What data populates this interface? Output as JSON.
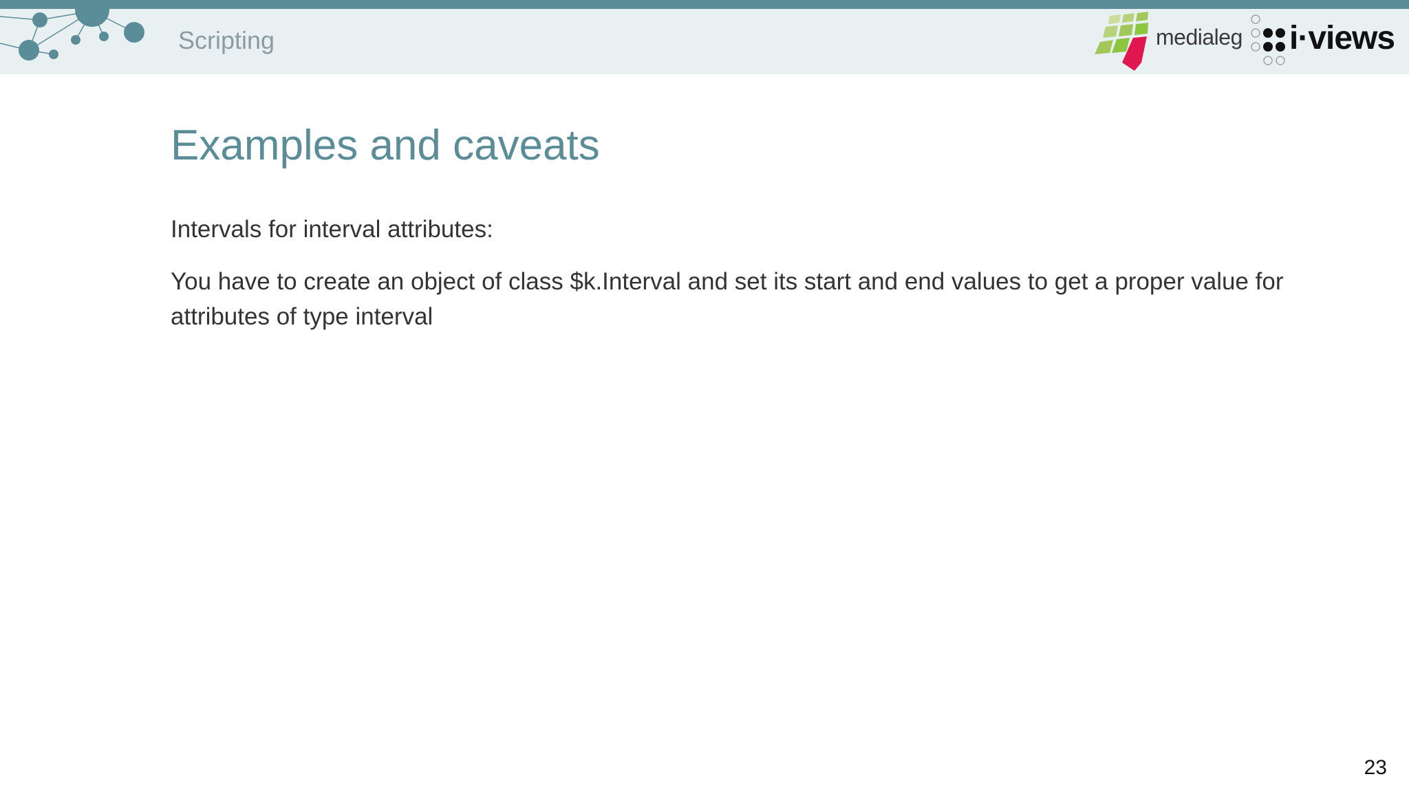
{
  "header": {
    "section": "Scripting",
    "medialeg_logo_text": "medialeg",
    "iviews_logo_text": "i·views"
  },
  "slide": {
    "title": "Examples and caveats",
    "subtitle": "Intervals for interval attributes:",
    "body": "You have to create an object of class $k.Interval and set its start and end values to get a proper value for attributes of type interval",
    "page_number": "23"
  },
  "colors": {
    "accent": "#5a8d97",
    "header_band": "#e9f0f2",
    "medialeg_green": "#8cc63f",
    "medialeg_red": "#e0174f"
  }
}
